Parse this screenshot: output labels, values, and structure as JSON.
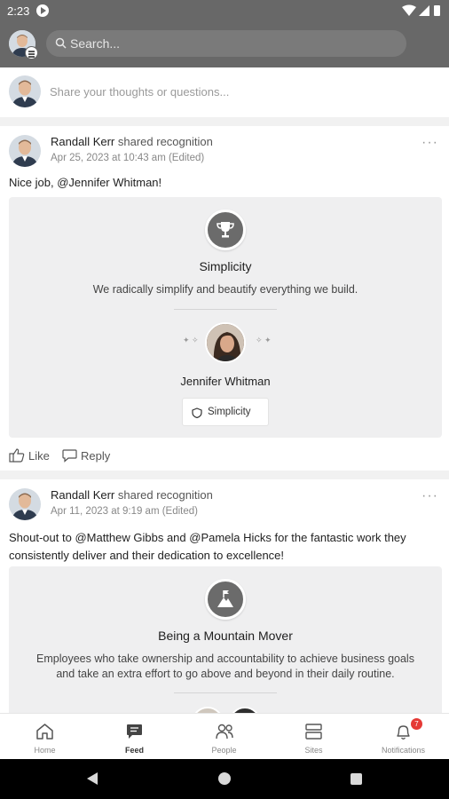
{
  "status_bar": {
    "time": "2:23"
  },
  "header": {
    "search_placeholder": "Search..."
  },
  "composer": {
    "placeholder": "Share your thoughts or questions..."
  },
  "posts": [
    {
      "author": "Randall Kerr",
      "action": "shared recognition",
      "date": "Apr 25, 2023 at 10:43 am (Edited)",
      "body": "Nice job, @Jennifer Whitman!",
      "value_title": "Simplicity",
      "value_description": "We radically simplify and beautify everything we build.",
      "recipient": "Jennifer Whitman",
      "chip_label": "Simplicity",
      "like_label": "Like",
      "reply_label": "Reply"
    },
    {
      "author": "Randall Kerr",
      "action": "shared recognition",
      "date": "Apr 11, 2023 at 9:19 am (Edited)",
      "body": "Shout-out to @Matthew Gibbs and @Pamela Hicks for the fantastic work they consistently deliver and their dedication to excellence!",
      "value_title": "Being a Mountain Mover",
      "value_description": "Employees who take ownership and accountability to achieve business goals and take an extra effort to go above and beyond in their daily routine."
    }
  ],
  "bottom_nav": [
    {
      "label": "Home",
      "icon": "home-icon"
    },
    {
      "label": "Feed",
      "icon": "feed-icon"
    },
    {
      "label": "People",
      "icon": "people-icon"
    },
    {
      "label": "Sites",
      "icon": "sites-icon"
    },
    {
      "label": "Notifications",
      "icon": "bell-icon",
      "badge": "7"
    }
  ]
}
